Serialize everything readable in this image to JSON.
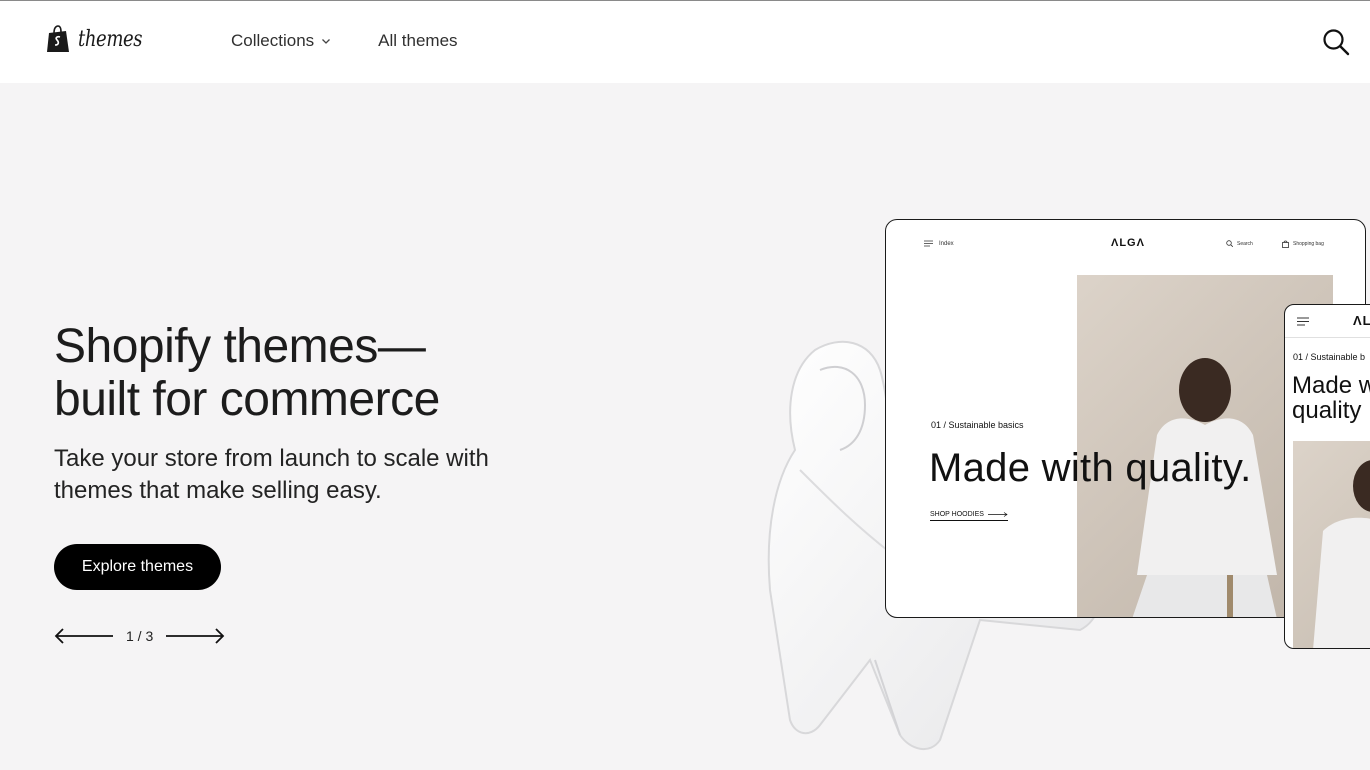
{
  "header": {
    "logo_text": "themes",
    "nav": [
      {
        "label": "Collections",
        "has_dropdown": true
      },
      {
        "label": "All themes",
        "has_dropdown": false
      }
    ],
    "search_icon": "search-icon"
  },
  "hero": {
    "title_line1": "Shopify themes—",
    "title_line2": "built for commerce",
    "subtitle": "Take your store from launch to scale with themes that make selling easy.",
    "cta_label": "Explore themes",
    "pager": "1 / 3"
  },
  "preview": {
    "desktop": {
      "menu_label": "Index",
      "brand": "ΛLGΛ",
      "search_label": "Search",
      "bag_label": "Shopping bag",
      "kicker": "01 / Sustainable basics",
      "headline": "Made with quality.",
      "link": "SHOP HOODIES"
    },
    "mobile": {
      "brand": "ΛLG",
      "kicker": "01 / Sustainable b",
      "headline_line1": "Made w",
      "headline_line2": "quality"
    }
  },
  "colors": {
    "page_bg": "#f5f4f5",
    "header_bg": "#ffffff",
    "cta_bg": "#000000",
    "cta_text": "#ffffff"
  }
}
